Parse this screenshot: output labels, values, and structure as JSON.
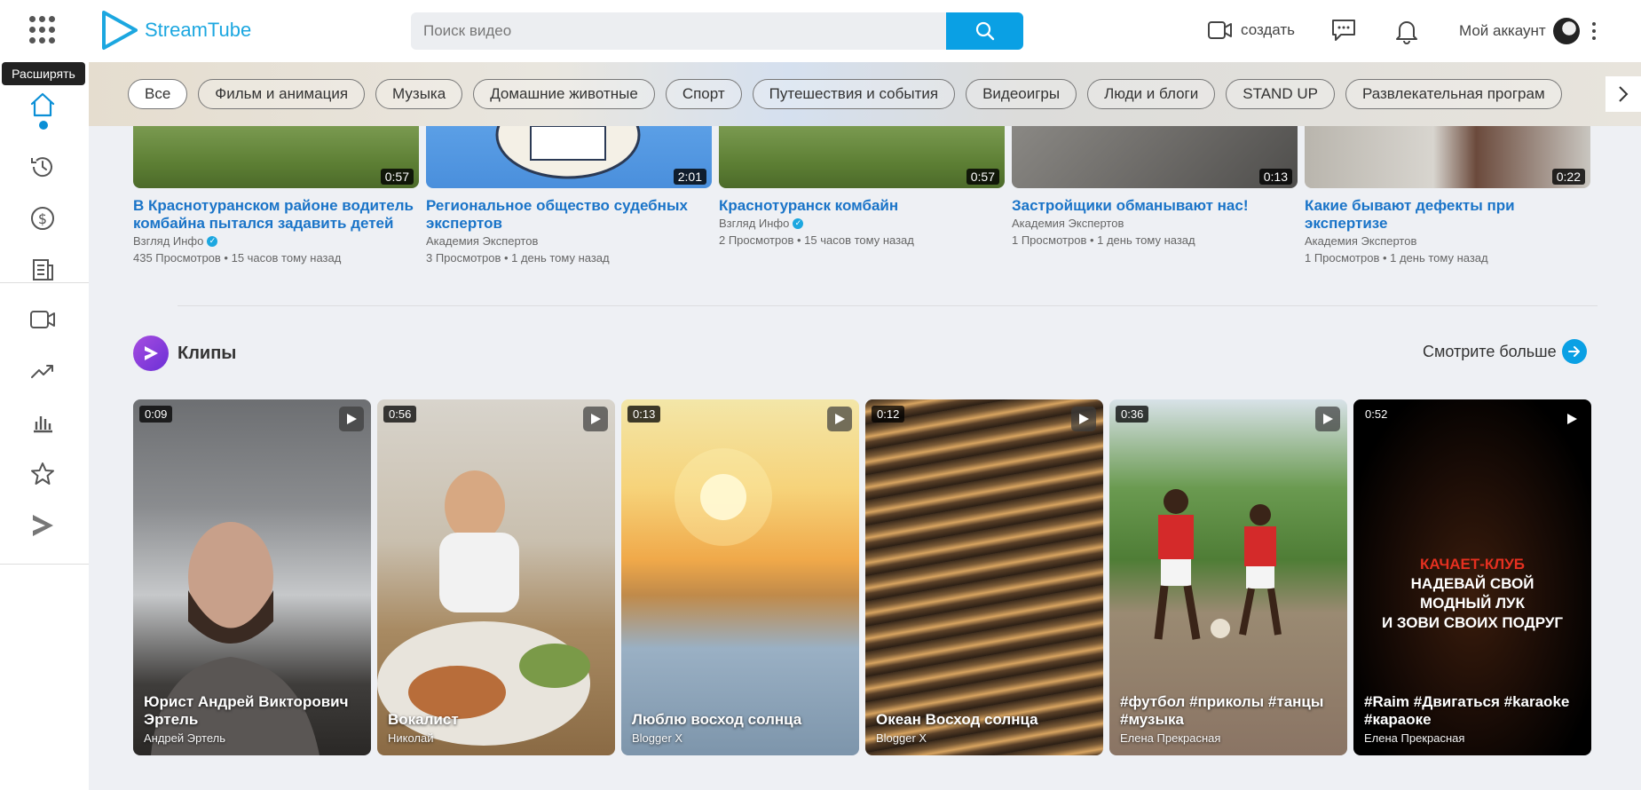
{
  "header": {
    "logo_text": "StreamTube",
    "search_placeholder": "Поиск видео",
    "create_label": "создать",
    "account_label": "Мой аккаунт"
  },
  "tooltip": "Расширять",
  "chips": [
    "Все",
    "Фильм и анимация",
    "Музыка",
    "Домашние животные",
    "Спорт",
    "Путешествия и события",
    "Видеоигры",
    "Люди и блоги",
    "STAND UP",
    "Развлекательная програм"
  ],
  "videos": [
    {
      "title": "В Краснотуранском районе водитель комбайна пытался задавить детей",
      "channel": "Взгляд Инфо",
      "verified": true,
      "meta": "435 Просмотров • 15 часов тому назад",
      "duration": "0:57"
    },
    {
      "title": "Региональное общество судебных экспертов",
      "channel": "Академия Экспертов",
      "verified": false,
      "meta": "3 Просмотров • 1 день тому назад",
      "duration": "2:01"
    },
    {
      "title": "Краснотуранск комбайн",
      "channel": "Взгляд Инфо",
      "verified": true,
      "meta": "2 Просмотров • 15 часов тому назад",
      "duration": "0:57"
    },
    {
      "title": "Застройщики обманывают нас!",
      "channel": "Академия Экспертов",
      "verified": false,
      "meta": "1 Просмотров • 1 день тому назад",
      "duration": "0:13"
    },
    {
      "title": "Какие бывают дефекты при экспертизе",
      "channel": "Академия Экспертов",
      "verified": false,
      "meta": "1 Просмотров • 1 день тому назад",
      "duration": "0:22"
    }
  ],
  "clips_section": {
    "title": "Клипы",
    "see_more": "Смотрите больше"
  },
  "clips": [
    {
      "duration": "0:09",
      "title": "Юрист Андрей Викторович Эртель",
      "author": "Андрей Эртель"
    },
    {
      "duration": "0:56",
      "title": "Вокалист",
      "author": "Николай"
    },
    {
      "duration": "0:13",
      "title": "Люблю восход солнца",
      "author": "Blogger X"
    },
    {
      "duration": "0:12",
      "title": "Океан Восход солнца",
      "author": "Blogger X"
    },
    {
      "duration": "0:36",
      "title": "#футбол #приколы #танцы #музыка",
      "author": "Елена Прекрасная"
    },
    {
      "duration": "0:52",
      "title": "#Raim #Двигаться #karaoke #караоке",
      "author": "Елена Прекрасная"
    }
  ],
  "promo": {
    "line1": "КАЧАЕТ-КЛУБ",
    "line2": "НАДЕВАЙ СВОЙ",
    "line3": "МОДНЫЙ ЛУК",
    "line4": "И ЗОВИ СВОИХ ПОДРУГ"
  },
  "icons": {
    "sidebar": [
      "home-icon",
      "history-icon",
      "dollar-icon",
      "news-icon",
      "video-camera-icon",
      "trending-icon",
      "chart-icon",
      "star-icon",
      "clips-icon"
    ]
  },
  "colors": {
    "accent": "#0aa0e4",
    "link": "#1a74c8"
  }
}
